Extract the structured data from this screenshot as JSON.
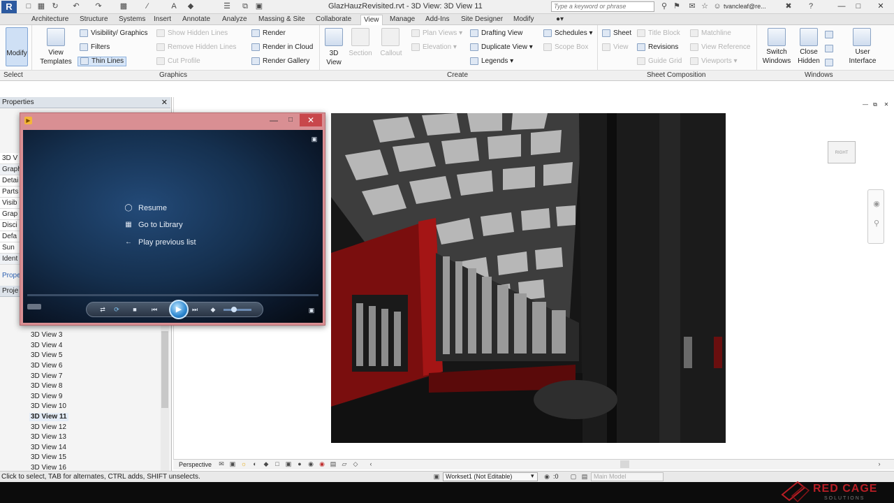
{
  "app": {
    "logo_letter": "R",
    "title": "GlazHauzRevisited.rvt - 3D View: 3D View 11",
    "search_placeholder": "Type a keyword or phrase",
    "user": "tvancleaf@re...",
    "brand_color": "#2c5aa0"
  },
  "tabs": [
    "Architecture",
    "Structure",
    "Systems",
    "Insert",
    "Annotate",
    "Analyze",
    "Massing & Site",
    "Collaborate",
    "View",
    "Manage",
    "Add-Ins",
    "Site Designer",
    "Modify"
  ],
  "active_tab": "View",
  "ribbon": {
    "modify_label": "Modify",
    "select_label": "Select",
    "view_templates_label": "View Templates",
    "visibility_label": "Visibility/ Graphics",
    "filters_label": "Filters",
    "thin_lines_label": "Thin Lines",
    "show_hidden_label": "Show Hidden Lines",
    "remove_hidden_label": "Remove Hidden Lines",
    "cut_profile_label": "Cut Profile",
    "render_label": "Render",
    "render_cloud_label": "Render in Cloud",
    "render_gallery_label": "Render Gallery",
    "view3d_label": "3D View",
    "section_label": "Section",
    "callout_label": "Callout",
    "plan_views_label": "Plan Views",
    "elevation_label": "Elevation",
    "drafting_view_label": "Drafting View",
    "duplicate_view_label": "Duplicate View",
    "legends_label": "Legends",
    "schedules_label": "Schedules",
    "scope_box_label": "Scope Box",
    "sheet_label": "Sheet",
    "view_label": "View",
    "title_block_label": "Title Block",
    "revisions_label": "Revisions",
    "guide_grid_label": "Guide Grid",
    "matchline_label": "Matchline",
    "view_reference_label": "View Reference",
    "viewports_label": "Viewports",
    "switch_windows_label": "Switch Windows",
    "close_hidden_label": "Close Hidden",
    "user_interface_label": "User Interface",
    "panels": [
      "Graphics",
      "Create",
      "Sheet Composition",
      "Windows"
    ]
  },
  "properties": {
    "title": "Properties",
    "rows": [
      "3D V",
      "Graph",
      "Detai",
      "Parts",
      "Visib",
      "Grap",
      "Disci",
      "Defa",
      "Sun",
      "Ident",
      "Prope"
    ]
  },
  "project_browser": {
    "title": "Proje",
    "views": [
      "3D View 3",
      "3D View 4",
      "3D View 5",
      "3D View 6",
      "3D View 7",
      "3D View 8",
      "3D View 9",
      "3D View 10",
      "3D View 11",
      "3D View 12",
      "3D View 13",
      "3D View 14",
      "3D View 15",
      "3D View 16"
    ],
    "current_view": "3D View 11"
  },
  "canvas": {
    "viewcube_label": "RIGHT"
  },
  "player": {
    "menu": [
      {
        "icon": "resume-icon",
        "label": "Resume"
      },
      {
        "icon": "library-icon",
        "label": "Go to Library"
      },
      {
        "icon": "back-arrow-icon",
        "label": "Play previous list"
      }
    ],
    "title_color": "#d98f93"
  },
  "viewbar": {
    "mode": "Perspective"
  },
  "status": {
    "hint": "Click to select, TAB for alternates, CTRL adds, SHIFT unselects.",
    "workset": "Workset1 (Not Editable)",
    "model": "Main Model",
    "zero": ":0"
  },
  "watermark": {
    "line1": "RED CAGE",
    "line2": "SOLUTIONS",
    "color": "#b81e25"
  }
}
